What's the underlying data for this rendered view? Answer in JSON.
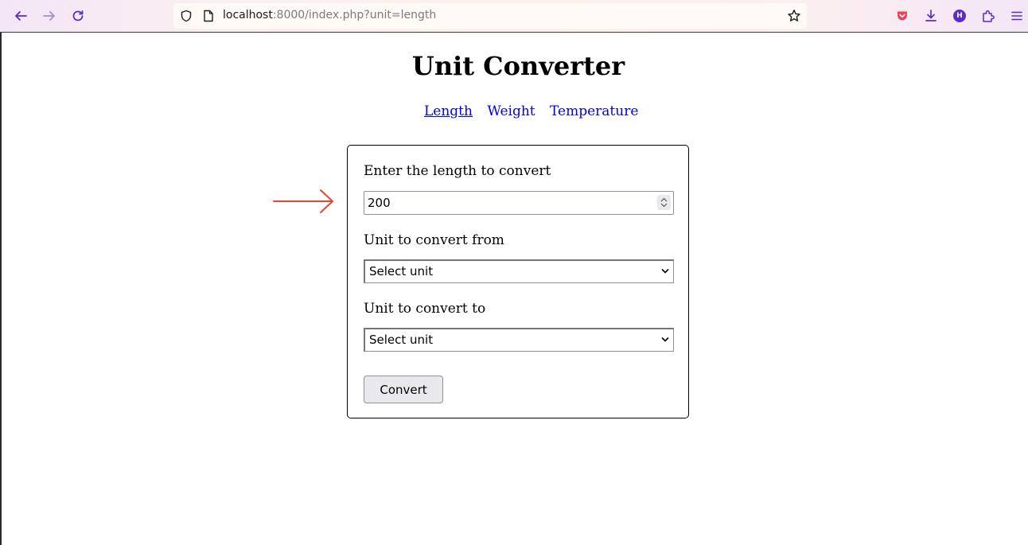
{
  "browser": {
    "url_host": "localhost",
    "url_rest": ":8000/index.php?unit=length",
    "profile_initial": "H"
  },
  "page": {
    "title": "Unit Converter",
    "nav": [
      {
        "label": "Length",
        "active": true
      },
      {
        "label": "Weight",
        "active": false
      },
      {
        "label": "Temperature",
        "active": false
      }
    ]
  },
  "form": {
    "length_label": "Enter the length to convert",
    "length_value": "200",
    "from_label": "Unit to convert from",
    "from_value": "Select unit",
    "to_label": "Unit to convert to",
    "to_value": "Select unit",
    "submit_label": "Convert"
  },
  "colors": {
    "link": "#0000ee",
    "annotation_arrow": "#e8432d",
    "button_bg": "#e9e9ed",
    "accent": "#5b2bc8"
  },
  "icons": [
    "back-arrow-icon",
    "forward-arrow-icon",
    "reload-icon",
    "shield-icon",
    "page-icon",
    "bookmark-star-icon",
    "pocket-icon",
    "download-icon",
    "profile-icon",
    "extensions-icon",
    "menu-icon",
    "spinner-icon",
    "chevron-down-icon",
    "annotation-arrow-icon"
  ]
}
